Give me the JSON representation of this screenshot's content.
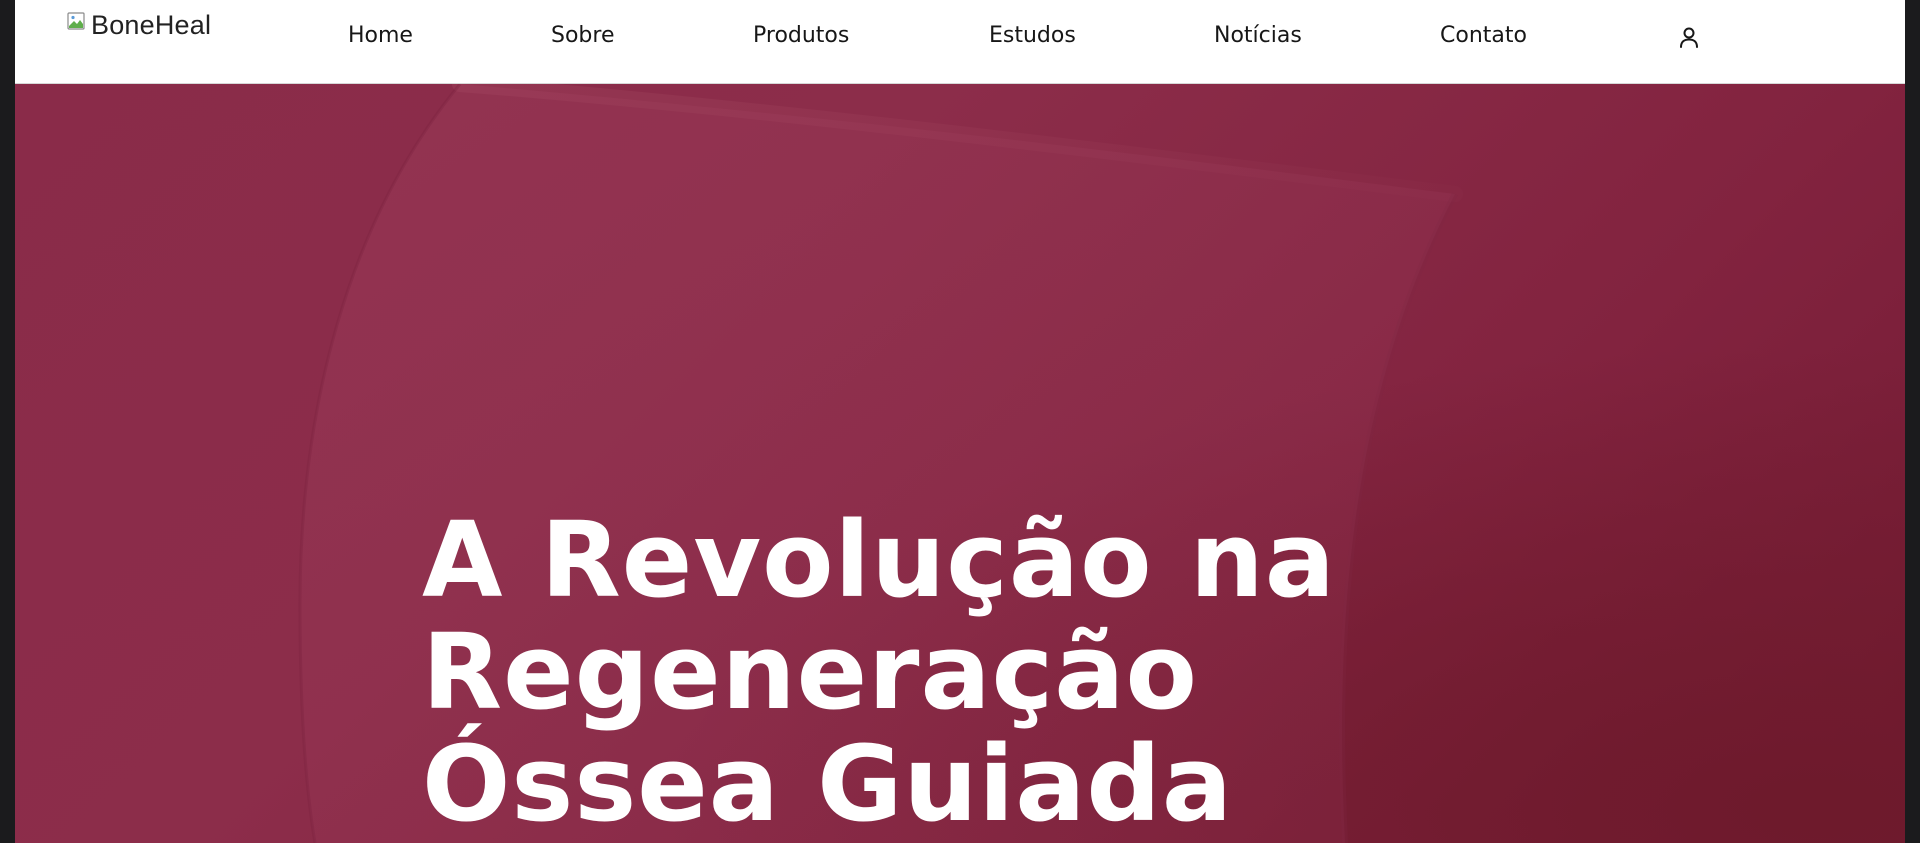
{
  "brand": {
    "logo_alt": "BoneHeal"
  },
  "nav": {
    "items": [
      {
        "label": "Home"
      },
      {
        "label": "Sobre"
      },
      {
        "label": "Produtos"
      },
      {
        "label": "Estudos"
      },
      {
        "label": "Notícias"
      },
      {
        "label": "Contato"
      }
    ],
    "account_icon": "user-icon"
  },
  "hero": {
    "title_lines": [
      "A Revolução na",
      "Regeneração",
      "Óssea Guiada"
    ],
    "background_color": "#8a2b49"
  },
  "colors": {
    "nav_background": "#ffffff",
    "nav_text": "#171717",
    "hero_background": "#8a2b49",
    "hero_text": "#ffffff",
    "page_frame": "#1b1b1d"
  }
}
